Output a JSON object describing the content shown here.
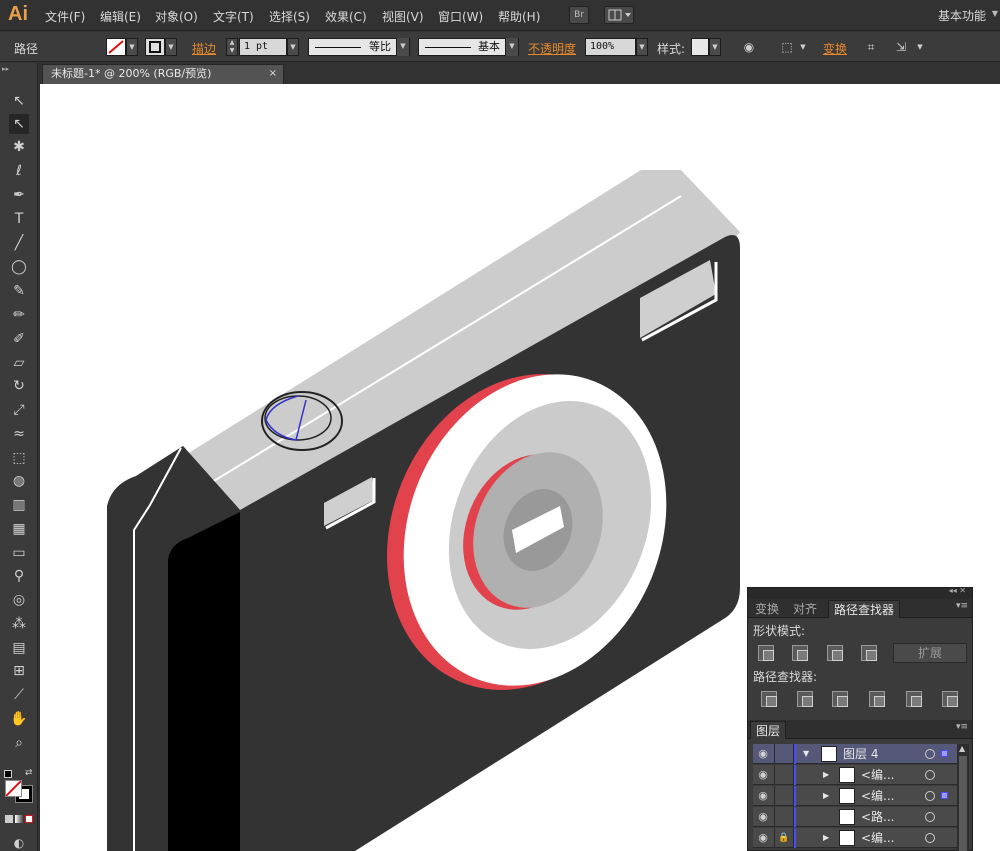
{
  "app": {
    "logo": "Ai"
  },
  "menubar": {
    "items": [
      "文件(F)",
      "编辑(E)",
      "对象(O)",
      "文字(T)",
      "选择(S)",
      "效果(C)",
      "视图(V)",
      "窗口(W)",
      "帮助(H)"
    ],
    "bridge_label": "Br",
    "workspace": "基本功能"
  },
  "controlbar": {
    "selection_type": "路径",
    "stroke_label": "描边",
    "stroke_weight": "1 pt",
    "variable_width": "等比",
    "brush": "基本",
    "opacity_label": "不透明度",
    "opacity_value": "100%",
    "style_label": "样式:",
    "transform_label": "变换"
  },
  "document": {
    "tab_title": "未标题-1* @ 200% (RGB/预览)",
    "close": "×"
  },
  "tools": [
    {
      "name": "selection-tool",
      "glyph": "↖"
    },
    {
      "name": "direct-selection-tool",
      "glyph": "↖"
    },
    {
      "name": "magic-wand-tool",
      "glyph": "✱"
    },
    {
      "name": "lasso-tool",
      "glyph": "ℓ"
    },
    {
      "name": "pen-tool",
      "glyph": "✒"
    },
    {
      "name": "type-tool",
      "glyph": "T"
    },
    {
      "name": "line-tool",
      "glyph": "╱"
    },
    {
      "name": "ellipse-tool",
      "glyph": "◯"
    },
    {
      "name": "paintbrush-tool",
      "glyph": "✎"
    },
    {
      "name": "pencil-tool",
      "glyph": "✏"
    },
    {
      "name": "blob-brush-tool",
      "glyph": "✐"
    },
    {
      "name": "eraser-tool",
      "glyph": "▱"
    },
    {
      "name": "rotate-tool",
      "glyph": "↻"
    },
    {
      "name": "scale-tool",
      "glyph": "⤢"
    },
    {
      "name": "warp-tool",
      "glyph": "≈"
    },
    {
      "name": "free-transform-tool",
      "glyph": "⬚"
    },
    {
      "name": "shape-builder-tool",
      "glyph": "◍"
    },
    {
      "name": "graph-tool",
      "glyph": "▥"
    },
    {
      "name": "mesh-tool",
      "glyph": "▦"
    },
    {
      "name": "gradient-tool",
      "glyph": "▭"
    },
    {
      "name": "eyedropper-tool",
      "glyph": "⚲"
    },
    {
      "name": "blend-tool",
      "glyph": "◎"
    },
    {
      "name": "symbol-sprayer-tool",
      "glyph": "⁂"
    },
    {
      "name": "column-graph-tool",
      "glyph": "▤"
    },
    {
      "name": "artboard-tool",
      "glyph": "⊞"
    },
    {
      "name": "slice-tool",
      "glyph": "⟋"
    },
    {
      "name": "hand-tool",
      "glyph": "✋"
    },
    {
      "name": "zoom-tool",
      "glyph": "⌕"
    }
  ],
  "panels": {
    "tabs": [
      "变换",
      "对齐",
      "路径查找器"
    ],
    "shape_modes_label": "形状模式:",
    "pathfinders_label": "路径查找器:",
    "expand_label": "扩展",
    "layers_tab": "图层",
    "layers": [
      {
        "name": "图层 4",
        "type": "layer"
      },
      {
        "name": "<编...",
        "type": "sublayer"
      },
      {
        "name": "<编...",
        "type": "sublayer"
      },
      {
        "name": "<路...",
        "type": "sublayer"
      },
      {
        "name": "<编...",
        "type": "sublayer"
      }
    ]
  },
  "colors": {
    "accent_orange": "#e8892c",
    "camera_body": "#333333",
    "camera_top": "#cccccc",
    "lens_red": "#e2424b",
    "layer_color": "#4a4aff"
  }
}
